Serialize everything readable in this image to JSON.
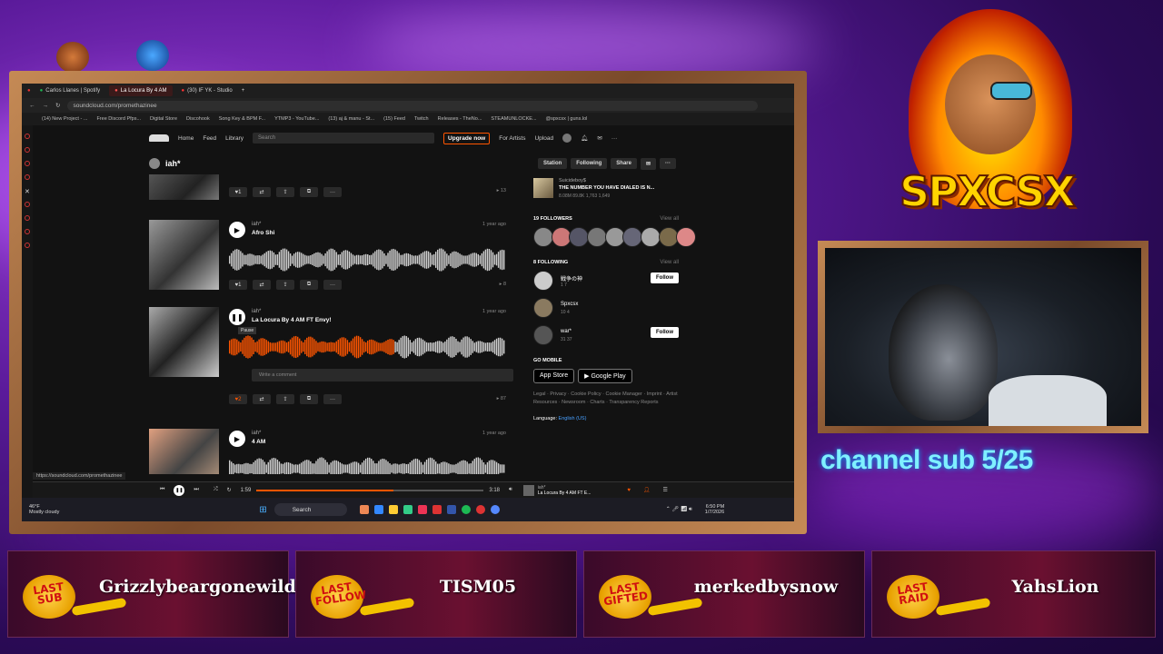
{
  "browser": {
    "tabs": [
      "Carlos Llanes | Spotify",
      "La Locura By 4 AM",
      "(30) IF YK - Studio"
    ],
    "url": "soundcloud.com/promethazinee",
    "bookmarks": [
      "(14) New Project - ...",
      "Free Discord Pfps...",
      "Digital Store",
      "Discohook",
      "Song Key & BPM F...",
      "YTMP3 - YouTube...",
      "(13) aj & manu - St...",
      "(15) Feed",
      "Twitch",
      "Releases - TheNo...",
      "STEAMUNLOCKE...",
      "@spxcsx | guns.lol"
    ],
    "status_url": "https://soundcloud.com/promethazinee"
  },
  "soundcloud": {
    "nav": [
      "Home",
      "Feed",
      "Library"
    ],
    "search_placeholder": "Search",
    "upgrade": "Upgrade now",
    "for_artists": "For Artists",
    "upload": "Upload",
    "profile_name": "iah*",
    "buttons": [
      "Station",
      "Following",
      "Share"
    ],
    "tracks": [
      {
        "artist": "iah*",
        "title": "Afro Shi",
        "date": "1 year ago",
        "likes": "1",
        "plays": "8",
        "duration": "2:30"
      },
      {
        "artist": "iah*",
        "title": "La Locura By 4 AM FT Envy!",
        "date": "1 year ago",
        "likes": "2",
        "plays": "87",
        "tooltip": "Pause",
        "elapsed": "1:09",
        "duration": "3:18"
      },
      {
        "artist": "iah*",
        "title": "4 AM",
        "date": "1 year ago",
        "duration": "2:26"
      }
    ],
    "top_likes": "1",
    "top_plays": "13",
    "comment_placeholder": "Write a comment",
    "liked_track": {
      "artist": "Suicideboy$",
      "title": "THE NUMBER YOU HAVE DIALED IS N...",
      "stats": "8.08M  89.8K  1,763  1,649"
    },
    "followers_title": "19 FOLLOWERS",
    "following_title": "8 FOLLOWING",
    "view_all": "View all",
    "following": [
      {
        "name": "戦争の神",
        "stats": "1  7",
        "button": "Follow"
      },
      {
        "name": "Spxcsx",
        "stats": "10  4",
        "button": ""
      },
      {
        "name": "war*",
        "stats": "31  37",
        "button": "Follow"
      }
    ],
    "go_mobile": "GO MOBILE",
    "app_store": "App Store",
    "google_play": "Google Play",
    "footer_links": "Legal · Privacy · Cookie Policy · Cookie Manager · Imprint · Artist Resources · Newsroom · Charts · Transparency Reports",
    "language_label": "Language:",
    "language_value": "English (US)"
  },
  "player": {
    "elapsed": "1:59",
    "total": "3:18",
    "artist": "iah*",
    "title": "La Locura By 4 AM FT E..."
  },
  "taskbar": {
    "weather_temp": "46°F",
    "weather_desc": "Mostly cloudy",
    "search": "Search",
    "time": "6:50 PM",
    "date": "1/7/2026"
  },
  "overlay": {
    "logo": "SPXCSX",
    "channel_sub": "channel sub 5/25",
    "panels": [
      {
        "badge": "LAST SUB",
        "name": "Grizzlybeargonewild"
      },
      {
        "badge": "LAST FOLLOW",
        "name": "TISM05"
      },
      {
        "badge": "LAST GIFTED",
        "name": "merkedbysnow"
      },
      {
        "badge": "LAST RAID",
        "name": "YahsLion"
      }
    ]
  },
  "colors": {
    "accent": "#ff5500",
    "cyan": "#7ff0ff",
    "gold": "#ffd400"
  }
}
